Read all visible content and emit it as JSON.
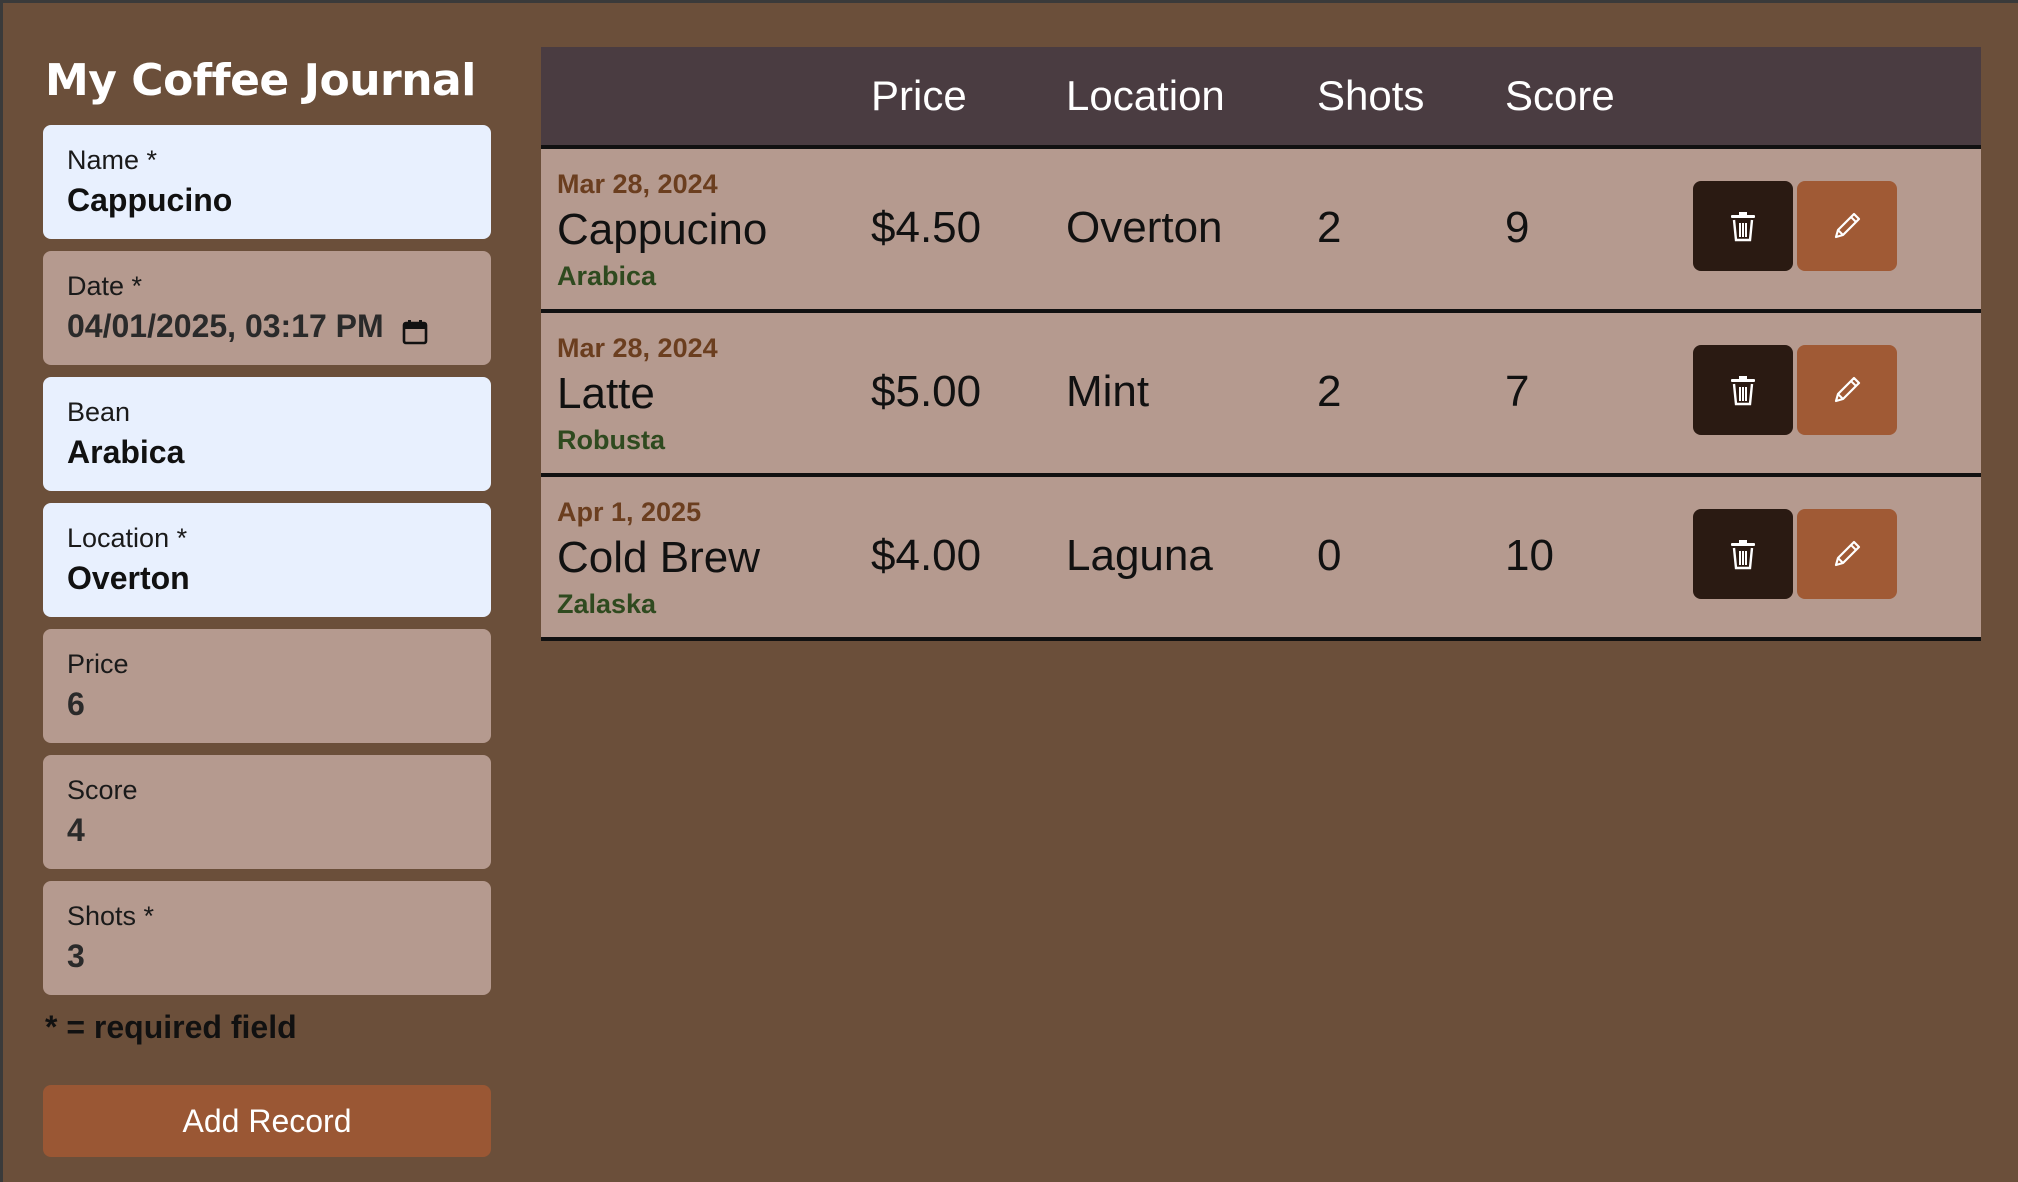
{
  "app": {
    "title": "My Coffee Journal"
  },
  "form": {
    "fields": [
      {
        "label": "Name *",
        "value": "Cappucino"
      },
      {
        "label": "Date *",
        "value": "04/01/2025, 03:17 PM"
      },
      {
        "label": "Bean",
        "value": "Arabica"
      },
      {
        "label": "Location *",
        "value": "Overton"
      },
      {
        "label": "Price",
        "value": "6"
      },
      {
        "label": "Score",
        "value": "4"
      },
      {
        "label": "Shots *",
        "value": "3"
      }
    ],
    "required_note": "* = required field",
    "submit_label": "Add Record"
  },
  "table": {
    "headers": {
      "price": "Price",
      "location": "Location",
      "shots": "Shots",
      "score": "Score"
    },
    "rows": [
      {
        "date": "Mar 28, 2024",
        "name": "Cappucino",
        "bean": "Arabica",
        "price": "$4.50",
        "location": "Overton",
        "shots": "2",
        "score": "9"
      },
      {
        "date": "Mar 28, 2024",
        "name": "Latte",
        "bean": "Robusta",
        "price": "$5.00",
        "location": "Mint",
        "shots": "2",
        "score": "7"
      },
      {
        "date": "Apr 1, 2025",
        "name": "Cold Brew",
        "bean": "Zalaska",
        "price": "$4.00",
        "location": "Laguna",
        "shots": "0",
        "score": "10"
      }
    ],
    "row_actions": {
      "delete_icon": "trash-icon",
      "edit_icon": "pencil-icon"
    }
  },
  "colors": {
    "background": "#6b4f3a",
    "header": "#4a3c41",
    "row": "#b59a8f",
    "field_active": "#e8f0fe",
    "field_inactive": "#b59a8f",
    "accent": "#9a5734",
    "delete_button": "#2a1a12",
    "date_text": "#6b3e1f",
    "bean_text": "#2f4a1f"
  }
}
